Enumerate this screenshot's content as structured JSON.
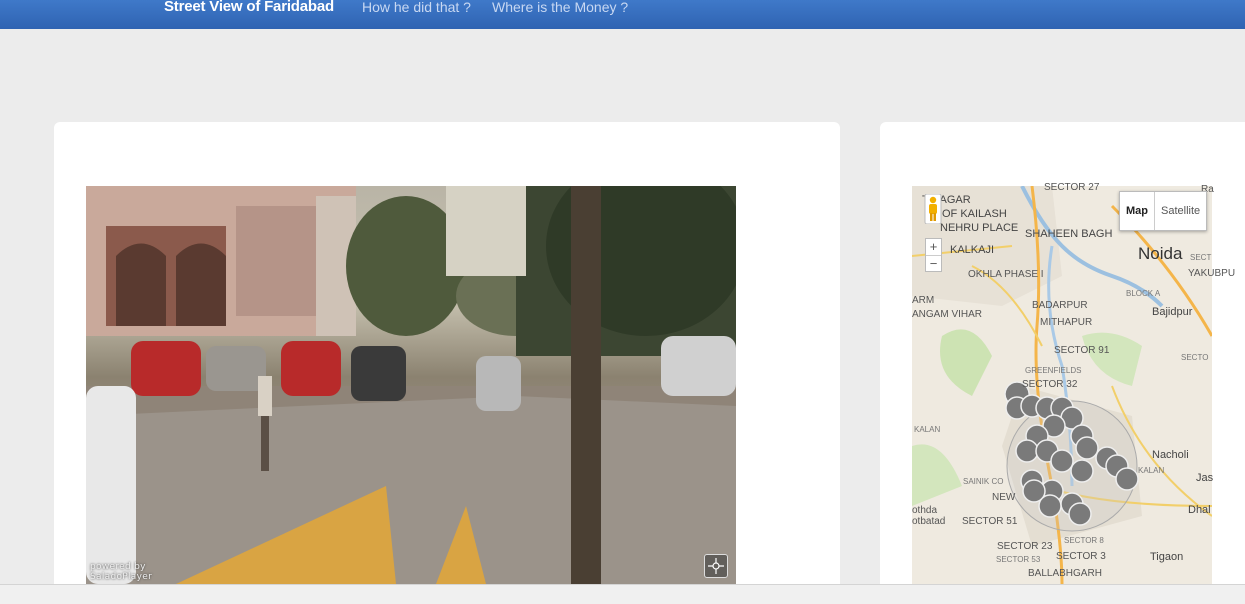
{
  "nav": {
    "brand": "Street View of Faridabad",
    "links": [
      "How he did that ?",
      "Where is the Money ?"
    ]
  },
  "panorama": {
    "powered_by": "powered by",
    "player": "SaladoPlayer",
    "fullscreen_icon": "fullscreen-icon"
  },
  "map": {
    "type_controls": [
      "Map",
      "Satellite"
    ],
    "zoom_in": "+",
    "zoom_out": "−",
    "labels": [
      "SECTOR 27",
      "T NAGAR",
      "OF KAILASH",
      "NEHRU PLACE",
      "SHAHEEN BAGH",
      "KALKAJI",
      "Noida",
      "YAKUBPU",
      "OKHLA PHASE I",
      "BLOCK A",
      "ARM",
      "BADARPUR",
      "Bajidpur",
      "ANGAM VIHAR",
      "MITHAPUR",
      "SECTOR 91",
      "GREENFIELDS",
      "SECTOR 32",
      "KALAN",
      "Nacholi",
      "KALAN",
      "Jas",
      "SAINIK CO",
      "NEW",
      "othda",
      "Dhal",
      "otbatad",
      "SECTOR 51",
      "SECTOR 8",
      "SECTOR 23",
      "SECTOR 3",
      "Tigaon",
      "SECTOR 53",
      "BALLABHGARH",
      "SECT",
      "SECTO",
      "Ra"
    ]
  },
  "colors": {
    "nav_bg": "#2f63b2",
    "page_bg": "#ececec",
    "marker": "#7a7a7a"
  }
}
